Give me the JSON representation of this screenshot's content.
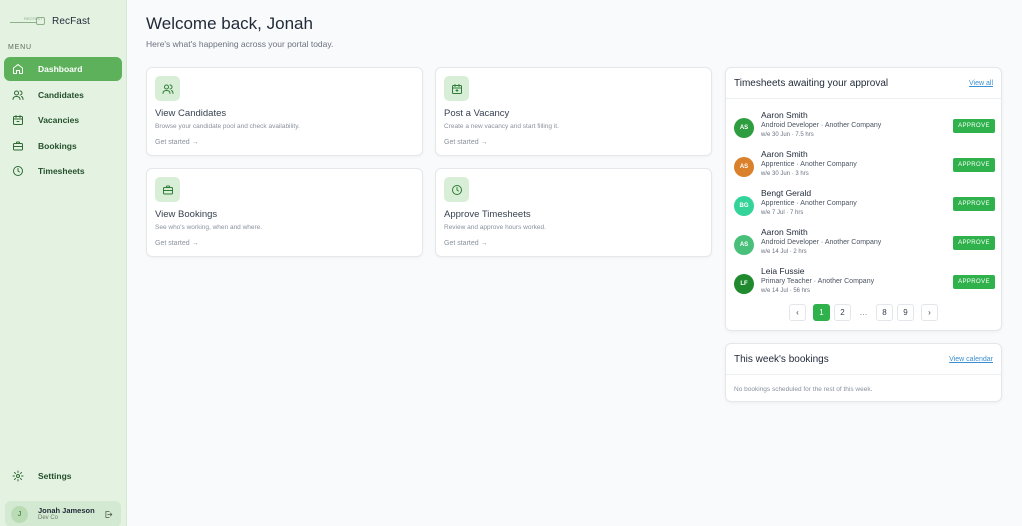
{
  "brand": {
    "name": "RecFast",
    "mark_text": "RECFAST"
  },
  "sidebar": {
    "menu_label": "MENU",
    "items": [
      {
        "label": "Dashboard",
        "icon": "home-icon",
        "active": true
      },
      {
        "label": "Candidates",
        "icon": "users-icon"
      },
      {
        "label": "Vacancies",
        "icon": "calendar-icon"
      },
      {
        "label": "Bookings",
        "icon": "briefcase-icon"
      },
      {
        "label": "Timesheets",
        "icon": "clock-icon"
      }
    ],
    "settings_label": "Settings"
  },
  "user": {
    "initial": "J",
    "name": "Jonah Jameson",
    "org": "Dev Co"
  },
  "header": {
    "title": "Welcome back, Jonah",
    "subtitle": "Here's what's happening across your portal today."
  },
  "cards": [
    {
      "title": "View Candidates",
      "desc": "Browse your candidate pool and check availability.",
      "cta": "Get started →",
      "icon": "users-icon"
    },
    {
      "title": "Post a Vacancy",
      "desc": "Create a new vacancy and start filling it.",
      "cta": "Get started →",
      "icon": "calendar-plus-icon"
    },
    {
      "title": "View Bookings",
      "desc": "See who's working, when and where.",
      "cta": "Get started →",
      "icon": "briefcase-icon"
    },
    {
      "title": "Approve Timesheets",
      "desc": "Review and approve hours worked.",
      "cta": "Get started →",
      "icon": "clock-icon"
    }
  ],
  "timesheets": {
    "title": "Timesheets awaiting your approval",
    "view_all": "View all",
    "approve_label": "APPROVE",
    "rows": [
      {
        "initials": "AS",
        "name": "Aaron Smith",
        "role": "Android Developer · Another Company",
        "meta": "w/e 30 Jun · 7.5 hrs",
        "color": "#2e9d3f"
      },
      {
        "initials": "AS",
        "name": "Aaron Smith",
        "role": "Apprentice · Another Company",
        "meta": "w/e 30 Jun · 3 hrs",
        "color": "#d9822b"
      },
      {
        "initials": "BG",
        "name": "Bengt Gerald",
        "role": "Apprentice · Another Company",
        "meta": "w/e 7 Jul · 7 hrs",
        "color": "#34d399"
      },
      {
        "initials": "AS",
        "name": "Aaron Smith",
        "role": "Android Developer · Another Company",
        "meta": "w/e 14 Jul · 2 hrs",
        "color": "#49c07a"
      },
      {
        "initials": "LF",
        "name": "Leia Fussie",
        "role": "Primary Teacher · Another Company",
        "meta": "w/e 14 Jul · 56 hrs",
        "color": "#1f8a2e"
      }
    ],
    "pagination": {
      "prev": "‹",
      "pages": [
        "1",
        "2",
        "…",
        "8",
        "9"
      ],
      "current": "1",
      "next": "›"
    }
  },
  "bookings": {
    "title": "This week's bookings",
    "view_calendar": "View calendar",
    "empty": "No bookings scheduled for the rest of this week."
  },
  "colors": {
    "accent": "#2fb24c",
    "sidebar_bg": "#e4f2e2",
    "nav_active": "#5cb15a"
  }
}
